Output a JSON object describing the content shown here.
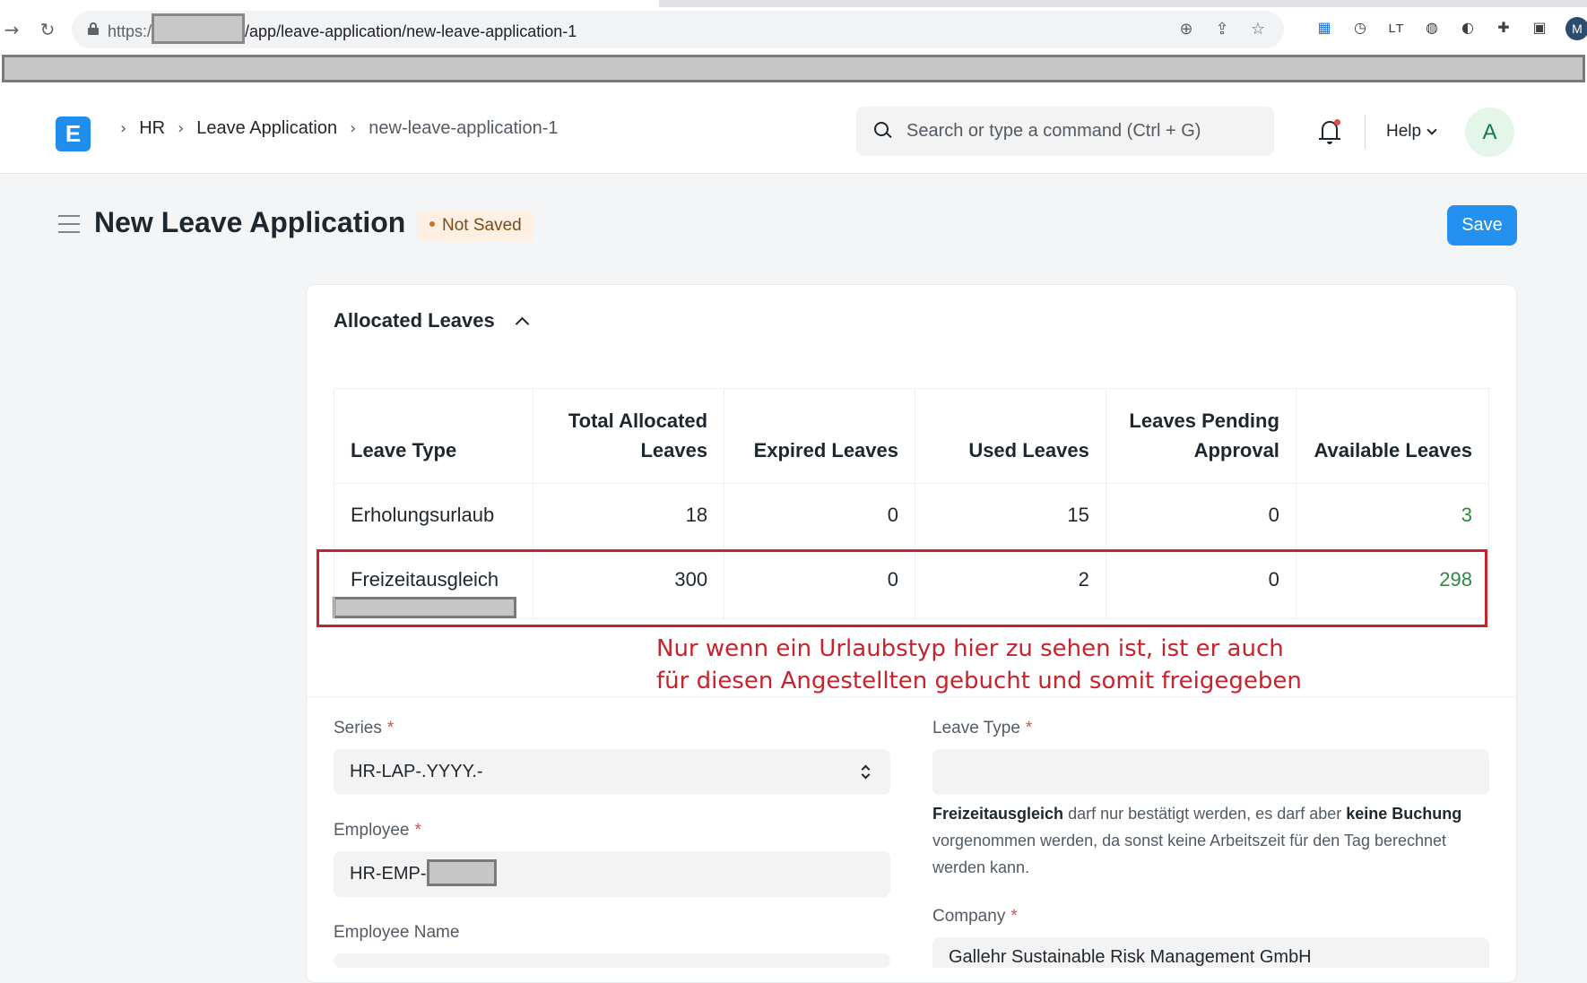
{
  "browser": {
    "url_prefix": "https:/",
    "url_path": "/app/leave-application/new-leave-application-1",
    "profile_initial": "M"
  },
  "navbar": {
    "logo_letter": "E",
    "breadcrumbs": [
      "HR",
      "Leave Application",
      "new-leave-application-1"
    ],
    "search_placeholder": "Search or type a command (Ctrl + G)",
    "help_label": "Help",
    "avatar_initial": "A"
  },
  "page": {
    "title": "New Leave Application",
    "status": "Not Saved",
    "save_label": "Save"
  },
  "allocated_leaves": {
    "section_title": "Allocated Leaves",
    "columns": [
      "Leave Type",
      "Total Allocated Leaves",
      "Expired Leaves",
      "Used Leaves",
      "Leaves Pending Approval",
      "Available Leaves"
    ],
    "rows": [
      {
        "leave_type": "Erholungsurlaub",
        "total": "18",
        "expired": "0",
        "used": "15",
        "pending": "0",
        "available": "3"
      },
      {
        "leave_type": "Freizeitausgleich",
        "total": "300",
        "expired": "0",
        "used": "2",
        "pending": "0",
        "available": "298"
      }
    ],
    "annotation_line1": "Nur wenn ein Urlaubstyp hier zu sehen ist, ist er auch",
    "annotation_line2": "für diesen Angestellten gebucht und somit freigegeben"
  },
  "form": {
    "series_label": "Series",
    "series_value": "HR-LAP-.YYYY.-",
    "employee_label": "Employee",
    "employee_value": "HR-EMP-",
    "employee_name_label": "Employee Name",
    "leave_type_label": "Leave Type",
    "leave_type_value": "",
    "leave_type_help": {
      "part1_bold": "Freizeitausgleich",
      "part2": " darf nur bestätigt werden, es darf aber ",
      "part3_bold": "keine Buchung",
      "part4": " vorgenommen werden, da sonst keine Arbeitszeit für den Tag berechnet werden kann."
    },
    "company_label": "Company",
    "company_value": "Gallehr Sustainable Risk Management GmbH",
    "required_marker": "*"
  },
  "colors": {
    "primary": "#2490ef",
    "available_green": "#2d8a3b",
    "annotation_red": "#c8232c",
    "badge_bg": "#fdf0e3"
  }
}
